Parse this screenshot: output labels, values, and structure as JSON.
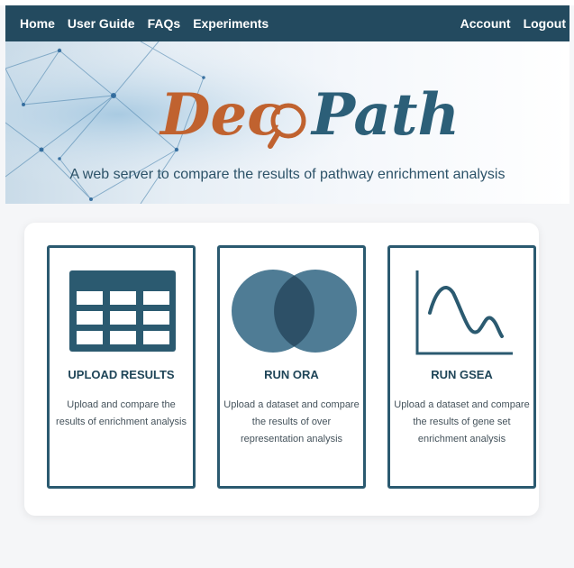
{
  "nav": {
    "left": [
      "Home",
      "User Guide",
      "FAQs",
      "Experiments"
    ],
    "right": [
      "Account",
      "Logout"
    ]
  },
  "hero": {
    "logo_part1": "Dec",
    "logo_part2": "Path",
    "tagline": "A web server to compare the results of pathway enrichment analysis"
  },
  "cards": [
    {
      "icon": "table-icon",
      "title": "UPLOAD RESULTS",
      "description": "Upload and compare the results of enrichment analysis"
    },
    {
      "icon": "venn-diagram-icon",
      "title": "RUN ORA",
      "description": "Upload a dataset and compare the results of over representation analysis"
    },
    {
      "icon": "line-chart-icon",
      "title": "RUN GSEA",
      "description": "Upload a dataset and compare the results of gene set enrichment analysis"
    }
  ],
  "colors": {
    "navbar": "#234a5f",
    "accent_orange": "#c0622f",
    "accent_blue": "#2c5f78",
    "card_border": "#2b5a70"
  }
}
